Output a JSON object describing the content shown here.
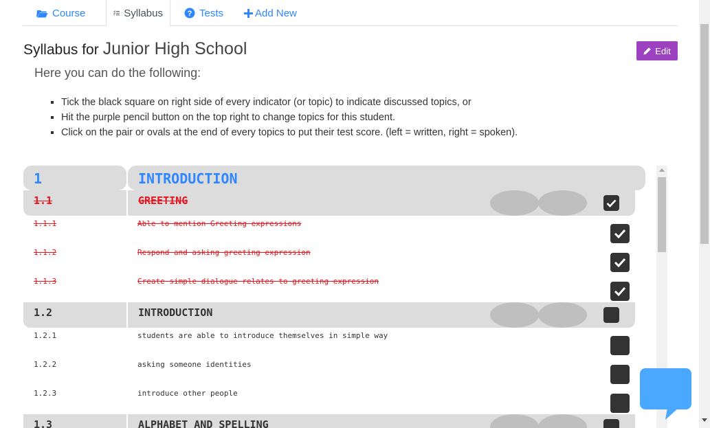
{
  "tabs": [
    {
      "label": "Course",
      "icon": "folder-open-icon",
      "active": false
    },
    {
      "label": "Syllabus",
      "icon": "list-check-icon",
      "active": true
    },
    {
      "label": "Tests",
      "icon": "question-circle-icon",
      "active": false
    },
    {
      "label": "Add New",
      "icon": "plus-icon",
      "active": false
    }
  ],
  "header": {
    "title_prefix": "Syllabus for",
    "school": "Junior High School",
    "edit_label": "Edit"
  },
  "intro": "Here you can do the following:",
  "instructions": [
    "Tick the black square on right side of every indicator (or topic) to indicate discussed topics, or",
    "Hit the purple pencil button on the top right to change topics for this student.",
    "Click on the pair or ovals at the end of every topics to put their test score. (left = written, right = spoken)."
  ],
  "syllabus": {
    "chapter": {
      "number": "1",
      "title": "INTRODUCTION"
    },
    "topics": [
      {
        "number": "1.1",
        "title": "GREETING",
        "done": true,
        "checked": true,
        "indicators": [
          {
            "number": "1.1.1",
            "text": "Able to mention Greeting expressions",
            "done": true,
            "checked": true
          },
          {
            "number": "1.1.2",
            "text": "Respond and asking greeting expression",
            "done": true,
            "checked": true
          },
          {
            "number": "1.1.3",
            "text": "Create simple dialogue relates to greeting expression",
            "done": true,
            "checked": true
          }
        ]
      },
      {
        "number": "1.2",
        "title": "INTRODUCTION",
        "done": false,
        "checked": false,
        "indicators": [
          {
            "number": "1.2.1",
            "text": "students are able to introduce themselves in simple way",
            "done": false,
            "checked": false
          },
          {
            "number": "1.2.2",
            "text": "asking someone identities",
            "done": false,
            "checked": false
          },
          {
            "number": "1.2.3",
            "text": "introduce other people",
            "done": false,
            "checked": false
          }
        ]
      },
      {
        "number": "1.3",
        "title": "ALPHABET AND SPELLING",
        "done": false,
        "checked": false,
        "indicators": []
      }
    ]
  },
  "colors": {
    "link": "#2f87ff",
    "edit_button": "#9c41bf",
    "done_text": "#e8141e",
    "row_bg": "#dcdcdc",
    "oval": "#bfbfbf",
    "chat_bubble": "#4aa8ff"
  }
}
